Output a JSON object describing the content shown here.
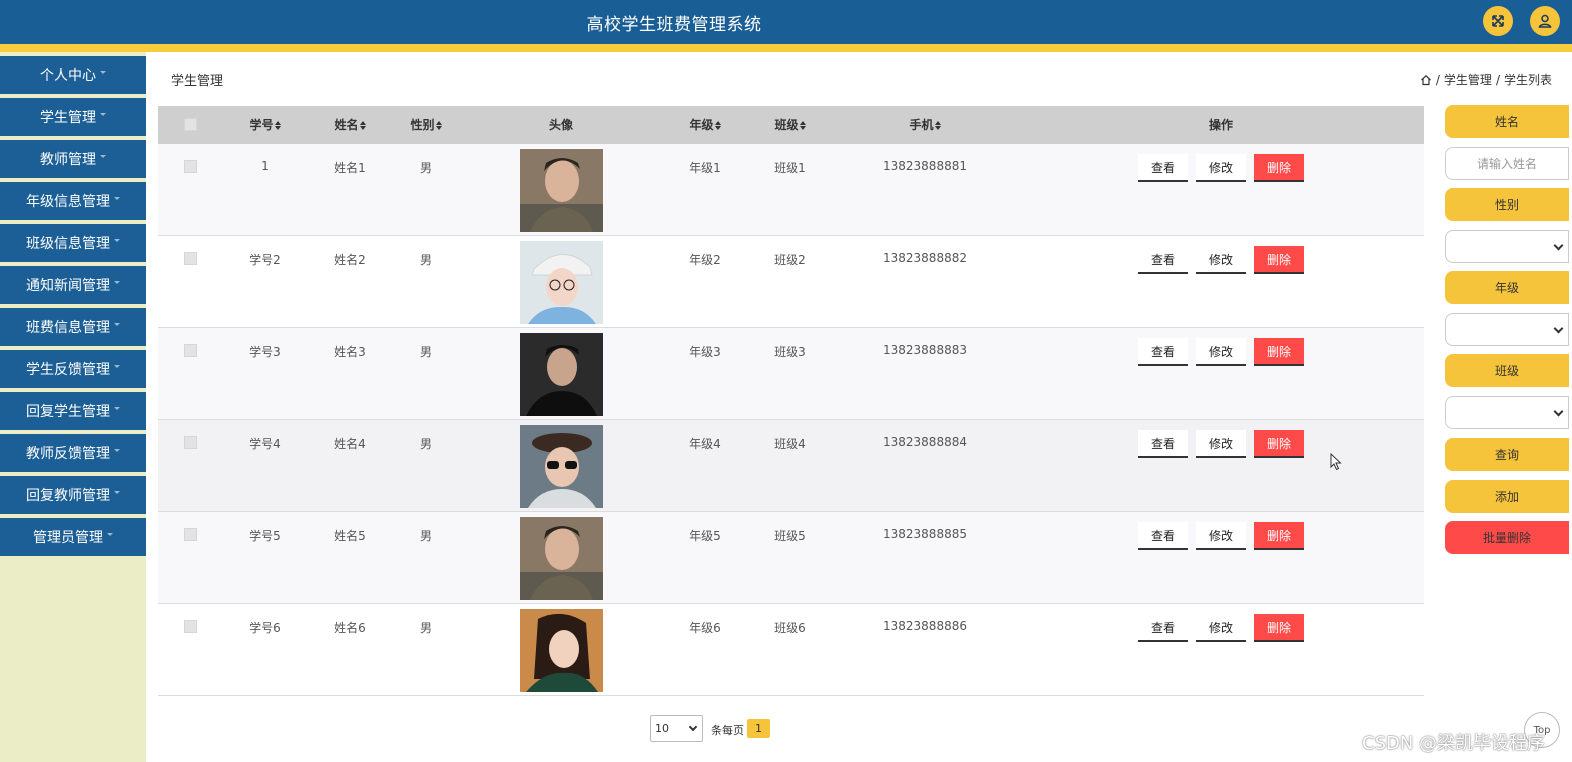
{
  "header": {
    "title": "高校学生班费管理系统",
    "fullscreen_icon": "fullscreen-icon",
    "user_icon": "user-icon",
    "colors": {
      "bar": "#1a5e96",
      "stripe": "#f6cd3c",
      "accent": "#f6c43a"
    }
  },
  "sidebar": {
    "items": [
      {
        "label": "个人中心"
      },
      {
        "label": "学生管理"
      },
      {
        "label": "教师管理"
      },
      {
        "label": "年级信息管理"
      },
      {
        "label": "班级信息管理"
      },
      {
        "label": "通知新闻管理"
      },
      {
        "label": "班费信息管理"
      },
      {
        "label": "学生反馈管理"
      },
      {
        "label": "回复学生管理"
      },
      {
        "label": "教师反馈管理"
      },
      {
        "label": "回复教师管理"
      },
      {
        "label": "管理员管理"
      }
    ]
  },
  "main": {
    "page_title": "学生管理",
    "breadcrumb": [
      "学生管理",
      "学生列表"
    ],
    "breadcrumb_separator": "/",
    "table": {
      "columns": {
        "id": "学号",
        "name": "姓名",
        "gender": "性别",
        "avatar": "头像",
        "grade": "年级",
        "class": "班级",
        "phone": "手机",
        "actions": "操作"
      },
      "rows": [
        {
          "id": "1",
          "name": "姓名1",
          "gender": "男",
          "grade": "年级1",
          "class": "班级1",
          "phone": "13823888881"
        },
        {
          "id": "学号2",
          "name": "姓名2",
          "gender": "男",
          "grade": "年级2",
          "class": "班级2",
          "phone": "13823888882"
        },
        {
          "id": "学号3",
          "name": "姓名3",
          "gender": "男",
          "grade": "年级3",
          "class": "班级3",
          "phone": "13823888883"
        },
        {
          "id": "学号4",
          "name": "姓名4",
          "gender": "男",
          "grade": "年级4",
          "class": "班级4",
          "phone": "13823888884"
        },
        {
          "id": "学号5",
          "name": "姓名5",
          "gender": "男",
          "grade": "年级5",
          "class": "班级5",
          "phone": "13823888885"
        },
        {
          "id": "学号6",
          "name": "姓名6",
          "gender": "男",
          "grade": "年级6",
          "class": "班级6",
          "phone": "13823888886"
        }
      ],
      "actions": {
        "view": "查看",
        "edit": "修改",
        "delete": "删除"
      }
    },
    "pagination": {
      "page_size": "10",
      "per_page_label": "条每页",
      "current_page": "1"
    }
  },
  "filters": {
    "name_label": "姓名",
    "name_placeholder": "请输入姓名",
    "gender_label": "性别",
    "grade_label": "年级",
    "class_label": "班级",
    "search_button": "查询",
    "add_button": "添加",
    "batch_delete_button": "批量删除",
    "colors": {
      "label": "#f6c43a",
      "danger": "#ff4a4a"
    }
  },
  "back_to_top": "Top",
  "watermark": "CSDN @梁凯毕设程序"
}
